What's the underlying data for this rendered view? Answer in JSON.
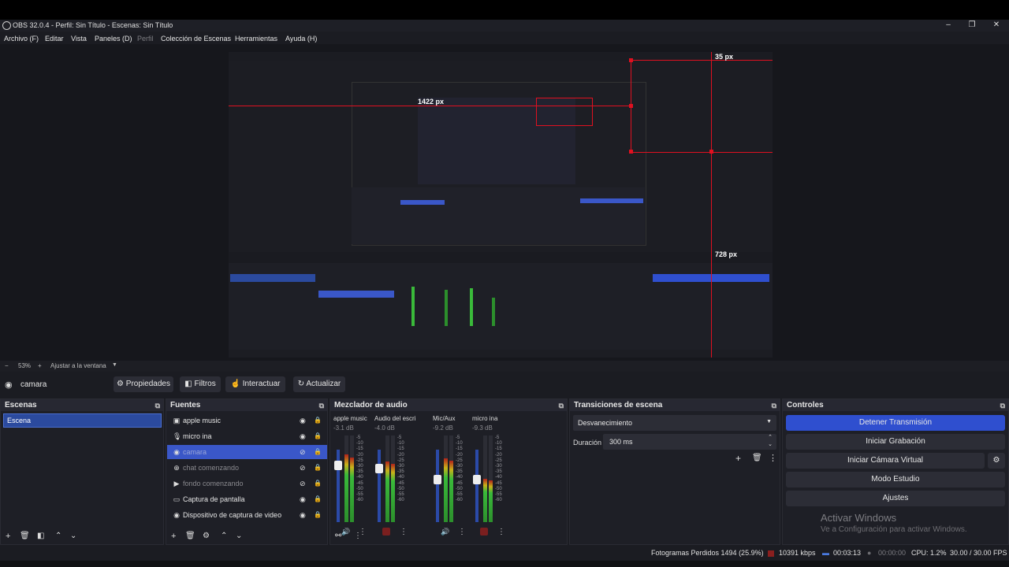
{
  "window": {
    "title": "OBS 32.0.4 - Perfil: Sin Título - Escenas: Sin Título"
  },
  "menu": [
    "Archivo (F)",
    "Editar",
    "Vista",
    "Paneles (D)",
    "Perfil",
    "Colección de Escenas",
    "Herramientas",
    "Ayuda (H)"
  ],
  "preview": {
    "labels": {
      "top": "35 px",
      "left": "1422 px",
      "bottom": "728 px"
    }
  },
  "zoom": {
    "minus": "−",
    "level": "53%",
    "plus": "+",
    "fit": "Ajustar a la ventana"
  },
  "source_toolbar": {
    "current": "camara",
    "props": "Propiedades",
    "filters": "Filtros",
    "interact": "Interactuar",
    "refresh": "Actualizar"
  },
  "scenes": {
    "title": "Escenas",
    "items": [
      "Escena"
    ]
  },
  "sources": {
    "title": "Fuentes",
    "items": [
      {
        "label": "apple music",
        "icon": "window-icon"
      },
      {
        "label": "micro ina",
        "icon": "microphone-icon"
      },
      {
        "label": "camara",
        "icon": "camera-icon"
      },
      {
        "label": "chat comenzando",
        "icon": "browser-icon"
      },
      {
        "label": "fondo comenzando",
        "icon": "play-icon"
      },
      {
        "label": "Captura de pantalla",
        "icon": "monitor-icon"
      },
      {
        "label": "Dispositivo de captura de video",
        "icon": "camera-icon"
      }
    ]
  },
  "mixer": {
    "title": "Mezclador de audio",
    "channels": [
      {
        "name": "apple music",
        "db": "-3.1 dB",
        "level": 0.78,
        "volume": 0.82,
        "muted": false
      },
      {
        "name": "Audio del escritorio",
        "db": "-4.0 dB",
        "level": 0.7,
        "volume": 0.78,
        "muted": true
      },
      {
        "name": "Mic/Aux",
        "db": "-9.2 dB",
        "level": 0.74,
        "volume": 0.6,
        "muted": false
      },
      {
        "name": "micro ina",
        "db": "-9.3 dB",
        "level": 0.5,
        "volume": 0.6,
        "muted": true
      }
    ],
    "scale": [
      "-5",
      "-10",
      "-15",
      "-20",
      "-25",
      "-30",
      "-35",
      "-40",
      "-45",
      "-50",
      "-55",
      "-60"
    ]
  },
  "transitions": {
    "title": "Transiciones de escena",
    "selected": "Desvanecimiento",
    "duration_label": "Duración",
    "duration_value": "300 ms"
  },
  "controls": {
    "title": "Controles",
    "stream": "Detener Transmisión",
    "record": "Iniciar Grabación",
    "virtual": "Iniciar Cámara Virtual",
    "studio": "Modo Estudio",
    "settings": "Ajustes"
  },
  "watermark": {
    "line1": "Activar Windows",
    "line2": "Ve a Configuración para activar Windows."
  },
  "status": {
    "dropped": "Fotogramas Perdidos 1494 (25.9%)",
    "kbps": "10391 kbps",
    "stream_time": "00:03:13",
    "rec_time": "00:00:00",
    "cpu": "CPU: 1.2%",
    "fps": "30.00 / 30.00 FPS"
  },
  "colors": {
    "accent": "#2f4fcf",
    "guide": "#e01020",
    "selection": "#3a57c8"
  }
}
